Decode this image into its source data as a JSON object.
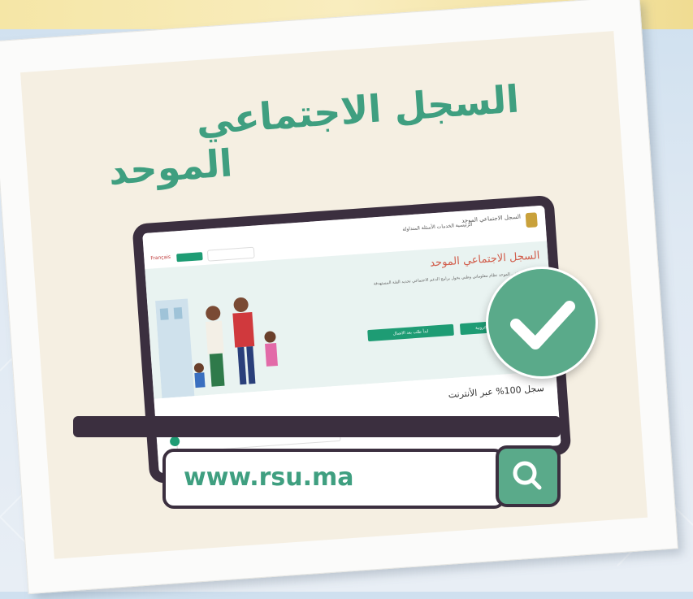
{
  "headline": {
    "line1": "السجل الاجتماعي",
    "line2": "الموحد"
  },
  "website": {
    "nav_logo_text": "السجل الاجتماعي الموحد",
    "nav_links": "الرئيسية  الخدمات  الأسئلة المتداولة",
    "nav_lang": "Français",
    "hero_title": "السجل الاجتماعي الموحد",
    "hero_text": "السجل الاجتماعي الموحد نظام معلوماتي وطني يخول برامج الدعم الاجتماعي تحديد الفئة المستهدفة",
    "hero_button_primary": "ابدأ طلب عبر البوابة الإلكترونية",
    "hero_button_secondary": "ابدأ طلب بعد الاتصال",
    "lower_title": "سجل 100% عبر الأنترنت"
  },
  "url": "www.rsu.ma",
  "icons": {
    "check": "check-icon",
    "search": "search-icon"
  },
  "colors": {
    "brand_green": "#3f9f80",
    "badge_green": "#5aaa8a",
    "laptop_frame": "#3b2f3f",
    "card_bg": "#f5efe2",
    "hero_title_red": "#d15c4a"
  }
}
